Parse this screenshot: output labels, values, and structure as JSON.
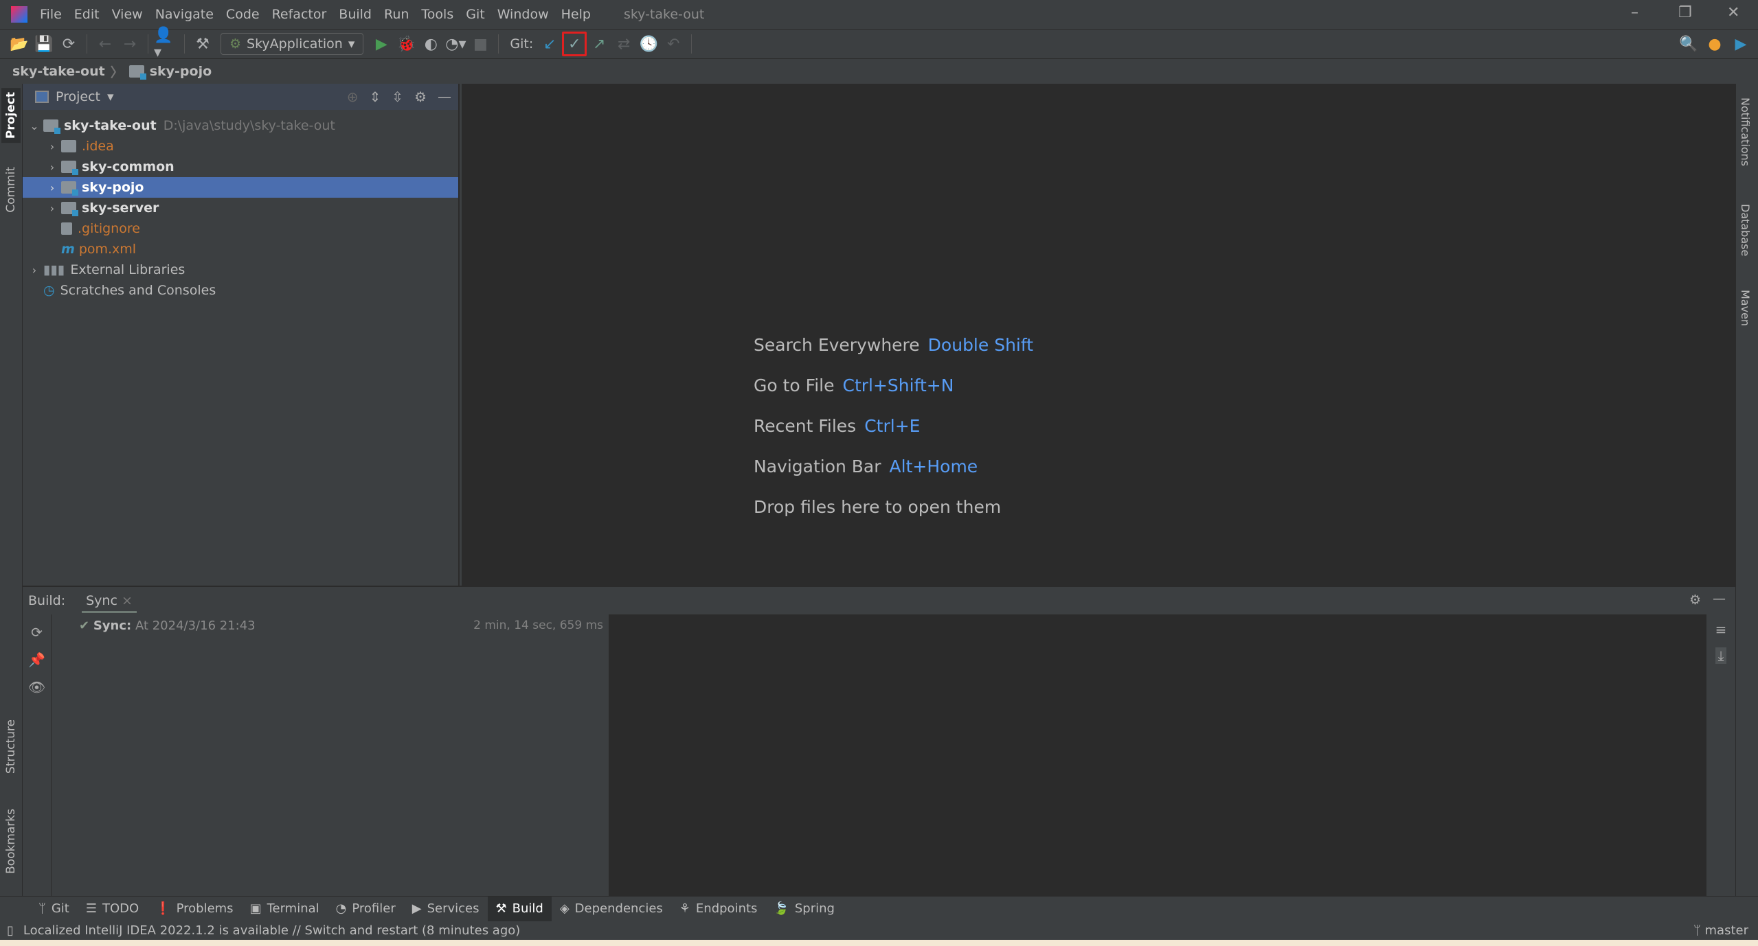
{
  "menubar": {
    "items": [
      "File",
      "Edit",
      "View",
      "Navigate",
      "Code",
      "Refactor",
      "Build",
      "Run",
      "Tools",
      "Git",
      "Window",
      "Help"
    ],
    "window_title": "sky-take-out"
  },
  "toolbar": {
    "run_config": "SkyApplication",
    "git_label": "Git:",
    "highlight_color": "#e02020"
  },
  "breadcrumb": {
    "root": "sky-take-out",
    "current": "sky-pojo"
  },
  "left_stripe": {
    "project": "Project",
    "commit": "Commit",
    "structure": "Structure",
    "bookmarks": "Bookmarks"
  },
  "right_stripe": {
    "notifications": "Notifications",
    "database": "Database",
    "maven": "Maven"
  },
  "project": {
    "title": "Project",
    "root": {
      "name": "sky-take-out",
      "path": "D:\\java\\study\\sky-take-out"
    },
    "items": [
      {
        "name": ".idea"
      },
      {
        "name": "sky-common"
      },
      {
        "name": "sky-pojo"
      },
      {
        "name": "sky-server"
      },
      {
        "name": ".gitignore"
      },
      {
        "name": "pom.xml"
      }
    ],
    "external": "External Libraries",
    "scratches": "Scratches and Consoles"
  },
  "editor": {
    "hints": [
      {
        "label": "Search Everywhere",
        "key": "Double Shift"
      },
      {
        "label": "Go to File",
        "key": "Ctrl+Shift+N"
      },
      {
        "label": "Recent Files",
        "key": "Ctrl+E"
      },
      {
        "label": "Navigation Bar",
        "key": "Alt+Home"
      },
      {
        "label": "Drop files here to open them",
        "key": ""
      }
    ]
  },
  "build": {
    "label": "Build:",
    "tab": "Sync",
    "sync_title": "Sync:",
    "sync_text": "At 2024/3/16 21:43",
    "duration": "2 min, 14 sec, 659 ms"
  },
  "tooltabs": [
    "Git",
    "TODO",
    "Problems",
    "Terminal",
    "Profiler",
    "Services",
    "Build",
    "Dependencies",
    "Endpoints",
    "Spring"
  ],
  "status": {
    "message": "Localized IntelliJ IDEA 2022.1.2 is available // Switch and restart (8 minutes ago)",
    "branch": "master"
  }
}
